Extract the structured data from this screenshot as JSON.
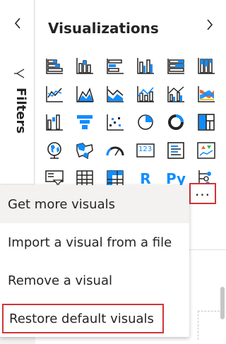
{
  "filters_pane": {
    "label": "Filters",
    "collapse_icon": "chevron-left-icon",
    "filter_icon": "filter-icon"
  },
  "visualizations_pane": {
    "title": "Visualizations",
    "expand_icon": "chevron-right-icon",
    "icons": [
      [
        "stacked-bar-chart-icon",
        "stacked-column-chart-icon",
        "clustered-bar-chart-icon",
        "clustered-column-chart-icon",
        "100-stacked-bar-chart-icon",
        "100-stacked-column-chart-icon"
      ],
      [
        "line-chart-icon",
        "area-chart-icon",
        "stacked-area-chart-icon",
        "line-and-stacked-column-chart-icon",
        "line-and-clustered-column-chart-icon",
        "ribbon-chart-icon"
      ],
      [
        "waterfall-chart-icon",
        "funnel-icon",
        "scatter-chart-icon",
        "pie-chart-icon",
        "donut-chart-icon",
        "treemap-icon"
      ],
      [
        "map-icon",
        "filled-map-icon",
        "gauge-icon",
        "card-icon",
        "multi-row-card-icon",
        "kpi-icon"
      ],
      [
        "slicer-icon",
        "table-icon",
        "matrix-icon",
        "r-script-visual-icon",
        "python-visual-icon",
        "key-influencers-icon"
      ]
    ],
    "r_label": "R",
    "py_label": "Py",
    "card_label": "123",
    "more_button": "..."
  },
  "menu": {
    "items": [
      "Get more visuals",
      "Import a visual from a file",
      "Remove a visual",
      "Restore default visuals"
    ]
  },
  "colors": {
    "accent": "#118dff",
    "dark": "#252423",
    "highlight_border": "#d13438",
    "yellow": "#f2c80f",
    "red": "#e66c37"
  }
}
